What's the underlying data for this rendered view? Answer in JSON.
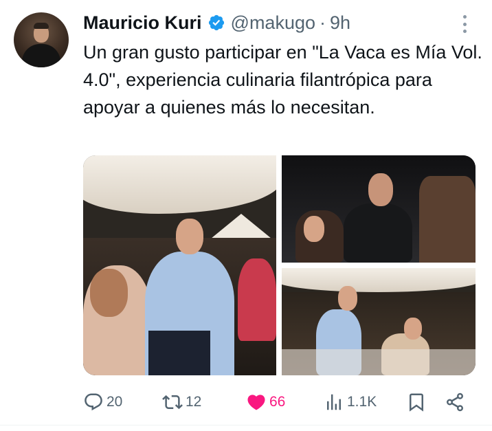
{
  "author": {
    "name": "Mauricio Kuri",
    "handle": "@makugo",
    "separator": "·",
    "time": "9h",
    "verified": true
  },
  "tweet": {
    "text": "Un gran gusto participar en \"La Vaca es Mía Vol. 4.0\", experiencia culinaria filantrópica para apoyar a quienes más lo necesitan."
  },
  "media": {
    "photos": [
      "photo-main",
      "photo-top-right",
      "photo-bottom-right"
    ]
  },
  "actions": {
    "replies": "20",
    "retweets": "12",
    "likes": "66",
    "views": "1.1K"
  },
  "colors": {
    "verified": "#1d9bf0",
    "like": "#f91880",
    "muted": "#536471",
    "text": "#0f1419"
  },
  "icons": {
    "reply": "speech-bubble-icon",
    "retweet": "retweet-icon",
    "like": "heart-icon",
    "views": "bar-chart-icon",
    "bookmark": "bookmark-icon",
    "share": "share-icon",
    "more": "more-dots-icon"
  }
}
